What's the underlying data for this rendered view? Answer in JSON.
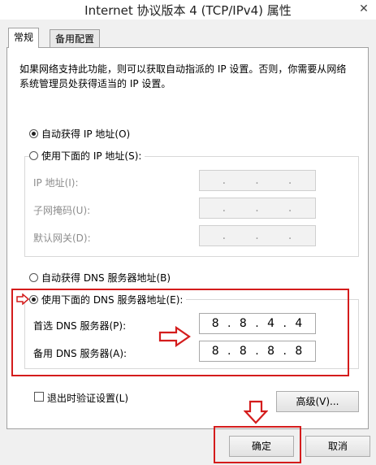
{
  "window": {
    "title": "Internet 协议版本 4 (TCP/IPv4) 属性",
    "close_glyph": "✕"
  },
  "tabs": [
    {
      "label": "常规",
      "active": true
    },
    {
      "label": "备用配置",
      "active": false
    }
  ],
  "description": "如果网络支持此功能，则可以获取自动指派的 IP 设置。否则，你需要从网络系统管理员处获得适当的 IP 设置。",
  "ip_section": {
    "auto_label": "自动获得 IP 地址(O)",
    "manual_label": "使用下面的 IP 地址(S):",
    "selected": "auto",
    "fields": [
      {
        "label": "IP 地址(I):",
        "value": [
          ".",
          ".",
          "."
        ]
      },
      {
        "label": "子网掩码(U):",
        "value": [
          ".",
          ".",
          "."
        ]
      },
      {
        "label": "默认网关(D):",
        "value": [
          ".",
          ".",
          "."
        ]
      }
    ]
  },
  "dns_section": {
    "auto_label": "自动获得 DNS 服务器地址(B)",
    "manual_label": "使用下面的 DNS 服务器地址(E):",
    "selected": "manual",
    "preferred": {
      "label": "首选 DNS 服务器(P):",
      "octets": [
        "8",
        ".",
        "8",
        ".",
        "4",
        ".",
        "4"
      ]
    },
    "alternate": {
      "label": "备用 DNS 服务器(A):",
      "octets": [
        "8",
        ".",
        "8",
        ".",
        "8",
        ".",
        "8"
      ]
    }
  },
  "validate_label": "退出时验证设置(L)",
  "validate_checked": false,
  "buttons": {
    "advanced": "高级(V)...",
    "ok": "确定",
    "cancel": "取消"
  },
  "colors": {
    "annotation_red": "#d41c1c"
  }
}
